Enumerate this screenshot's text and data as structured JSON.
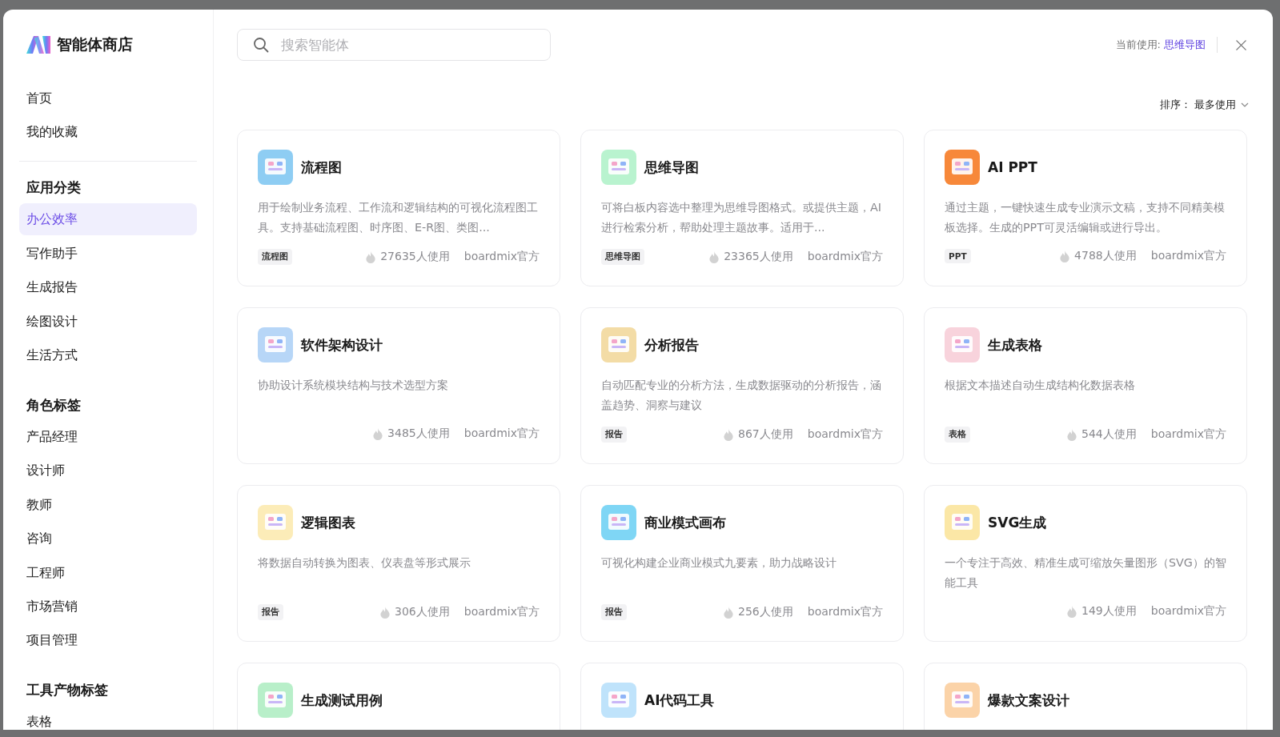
{
  "app": {
    "title": "智能体商店"
  },
  "sidebar": {
    "nav": [
      {
        "label": "首页",
        "selected": false
      },
      {
        "label": "我的收藏",
        "selected": false
      }
    ],
    "sections": [
      {
        "title": "应用分类",
        "items": [
          {
            "label": "办公效率",
            "selected": true
          },
          {
            "label": "写作助手",
            "selected": false
          },
          {
            "label": "生成报告",
            "selected": false
          },
          {
            "label": "绘图设计",
            "selected": false
          },
          {
            "label": "生活方式",
            "selected": false
          }
        ]
      },
      {
        "title": "角色标签",
        "items": [
          {
            "label": "产品经理",
            "selected": false
          },
          {
            "label": "设计师",
            "selected": false
          },
          {
            "label": "教师",
            "selected": false
          },
          {
            "label": "咨询",
            "selected": false
          },
          {
            "label": "工程师",
            "selected": false
          },
          {
            "label": "市场营销",
            "selected": false
          },
          {
            "label": "项目管理",
            "selected": false
          }
        ]
      },
      {
        "title": "工具产物标签",
        "items": [
          {
            "label": "表格",
            "selected": false
          }
        ]
      }
    ]
  },
  "search": {
    "placeholder": "搜索智能体"
  },
  "current_use": {
    "label": "当前使用:",
    "value": "思维导图"
  },
  "sort": {
    "label": "排序：",
    "value": "最多使用"
  },
  "agents": [
    {
      "name": "流程图",
      "description": "用于绘制业务流程、工作流和逻辑结构的可视化流程图工具。支持基础流程图、时序图、E-R图、类图...",
      "tag": "流程图",
      "usage": "27635人使用",
      "author": "boardmix官方",
      "color": "#8ecdf3"
    },
    {
      "name": "思维导图",
      "description": "可将白板内容选中整理为思维导图格式。或提供主题，AI进行检索分析，帮助处理主题故事。适用于...",
      "tag": "思维导图",
      "usage": "23365人使用",
      "author": "boardmix官方",
      "color": "#b9f3cf"
    },
    {
      "name": "AI PPT",
      "description": "通过主题，一键快速生成专业演示文稿，支持不同精美模板选择。生成的PPT可灵活编辑或进行导出。",
      "tag": "PPT",
      "usage": "4788人使用",
      "author": "boardmix官方",
      "color": "#f7883a"
    },
    {
      "name": "软件架构设计",
      "description": "协助设计系统模块结构与技术选型方案",
      "usage": "3485人使用",
      "author": "boardmix官方",
      "color": "#b7d6f7"
    },
    {
      "name": "分析报告",
      "description": "自动匹配专业的分析方法，生成数据驱动的分析报告，涵盖趋势、洞察与建议",
      "tag": "报告",
      "usage": "867人使用",
      "author": "boardmix官方",
      "color": "#f3dca6"
    },
    {
      "name": "生成表格",
      "description": "根据文本描述自动生成结构化数据表格",
      "tag": "表格",
      "usage": "544人使用",
      "author": "boardmix官方",
      "color": "#f8d3dc"
    },
    {
      "name": "逻辑图表",
      "description": "将数据自动转换为图表、仪表盘等形式展示",
      "tag": "报告",
      "usage": "306人使用",
      "author": "boardmix官方",
      "color": "#fcecb8"
    },
    {
      "name": "商业模式画布",
      "description": "可视化构建企业商业模式九要素，助力战略设计",
      "tag": "报告",
      "usage": "256人使用",
      "author": "boardmix官方",
      "color": "#7fd6f5"
    },
    {
      "name": "SVG生成",
      "description": "一个专注于高效、精准生成可缩放矢量图形（SVG）的智能工具",
      "usage": "149人使用",
      "author": "boardmix官方",
      "color": "#fbe7a6"
    },
    {
      "name": "生成测试用例",
      "color": "#b8efc9"
    },
    {
      "name": "AI代码工具",
      "color": "#bfe3fb"
    },
    {
      "name": "爆款文案设计",
      "color": "#fbd3a8"
    }
  ]
}
